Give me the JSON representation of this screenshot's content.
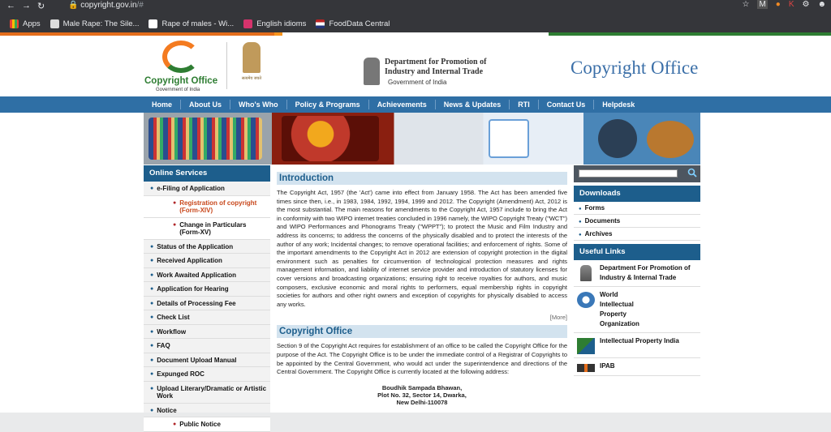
{
  "browser": {
    "url_host": "copyright.gov.in",
    "url_rest": "/#",
    "bookmarks": [
      "Apps",
      "Male Rape: The Sile...",
      "Rape of males - Wi...",
      "English idioms",
      "FoodData Central"
    ]
  },
  "header": {
    "logo_title": "Copyright Office",
    "logo_subtitle": "Government of India",
    "emblem_caption": "सत्यमेव जयते",
    "dipp_line1": "Department for Promotion of",
    "dipp_line2": "Industry and Internal Trade",
    "dipp_line3": "Government of India",
    "site_title": "Copyright Office"
  },
  "nav": [
    "Home",
    "About Us",
    "Who's Who",
    "Policy & Programs",
    "Achievements",
    "News & Updates",
    "RTI",
    "Contact Us",
    "Helpdesk"
  ],
  "online_services": {
    "title": "Online Services",
    "items": [
      {
        "label": "e-Filing of Application"
      },
      {
        "label": "Registration of copyright (Form-XIV)",
        "sub": true,
        "active": true
      },
      {
        "label": "Change in Particulars (Form-XV)",
        "sub": true
      },
      {
        "label": "Status of the Application"
      },
      {
        "label": "Received Application"
      },
      {
        "label": "Work Awaited Application"
      },
      {
        "label": "Application for Hearing"
      },
      {
        "label": "Details of Processing Fee"
      },
      {
        "label": "Check List"
      },
      {
        "label": "Workflow"
      },
      {
        "label": "FAQ"
      },
      {
        "label": "Document Upload Manual"
      },
      {
        "label": "Expunged ROC"
      },
      {
        "label": "Upload Literary/Dramatic or Artistic Work"
      },
      {
        "label": "Notice"
      },
      {
        "label": "Public Notice",
        "sub": true
      }
    ]
  },
  "main": {
    "intro_title": "Introduction",
    "intro_text": "The Copyright Act, 1957 (the 'Act') came into effect from January 1958. The Act has been amended five times since then, i.e., in 1983, 1984, 1992, 1994, 1999 and 2012. The Copyright (Amendment) Act, 2012 is the most substantial. The main reasons for amendments to the Copyright Act, 1957 include to bring the Act in conformity with two WIPO internet treaties concluded in 1996 namely, the WIPO Copyright Treaty (\"WCT\") and WIPO Performances and Phonograms Treaty (\"WPPT\"); to protect the Music and Film Industry and address its concerns; to address the concerns of the physically disabled and to protect the interests of the author of any work; Incidental changes; to remove operational facilities; and enforcement of rights. Some of the important amendments to the Copyright Act in 2012 are extension of copyright protection in the digital environment such as penalties for circumvention of technological protection measures and rights management information, and liability of internet service provider and introduction of statutory licenses for cover versions and broadcasting organizations; ensuring right to receive royalties for authors, and music composers, exclusive economic and moral rights to performers, equal membership rights in copyright societies for authors and other right owners and exception of copyrights for physically disabled to access any works.",
    "more": "[More]",
    "office_title": "Copyright Office",
    "office_text": "Section 9 of the Copyright Act requires for establishment of an office to be called the Copyright Office for the purpose of the Act. The Copyright Office is to be under the immediate control of a Registrar of Copyrights to be appointed by the Central Government, who would act under the superintendence and directions of the Central Government. The Copyright Office is currently located at the following address:",
    "address_line1": "Boudhik Sampada Bhawan,",
    "address_line2": "Plot No. 32, Sector 14, Dwarka,",
    "address_line3": "New Delhi-110078"
  },
  "right": {
    "downloads_title": "Downloads",
    "downloads": [
      "Forms",
      "Documents",
      "Archives"
    ],
    "useful_title": "Useful Links",
    "useful": [
      {
        "label": "Department For Promotion of Industry & Internal Trade",
        "icon": "emblem-icon"
      },
      {
        "label": "World Intellectual Property Organization",
        "icon": "wipo-icon"
      },
      {
        "label": "Intellectual Property India",
        "icon": "ipindia-icon"
      },
      {
        "label": "IPAB",
        "icon": "ipab-icon"
      }
    ]
  }
}
